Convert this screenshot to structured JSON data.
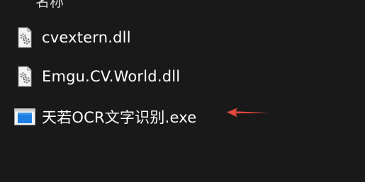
{
  "header": {
    "partial_label": "名称"
  },
  "files": [
    {
      "name": "cvextern.dll",
      "icon": "dll-file-icon"
    },
    {
      "name": "Emgu.CV.World.dll",
      "icon": "dll-file-icon"
    },
    {
      "name": "天若OCR文字识别.exe",
      "icon": "exe-app-icon"
    }
  ],
  "colors": {
    "background": "#191919",
    "text": "#ffffff",
    "annotation_arrow": "#e2483d",
    "exe_icon_blue": "#1e7fe0"
  },
  "annotation": {
    "icon": "red-arrow-icon"
  }
}
